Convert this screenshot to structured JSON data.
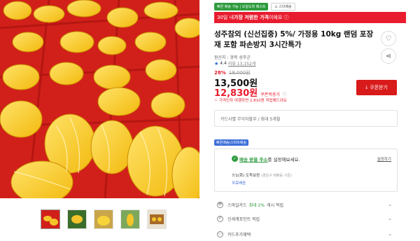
{
  "product": {
    "badge_green": "빠른 배송 가능 | 오늘도착 베스트",
    "badge_store": "스타배송",
    "promo_prefix": "30일 내 ",
    "promo_bold": "가장 저렴한 가격",
    "promo_suffix": "이에요 ⓘ",
    "title": "성주참외 (신선집중) 5%/ 가정용 10kg 랜덤 포장재 포함 파손방지 3시간특가",
    "origin": "원산지 : 경북 성주군",
    "rating": "4.4",
    "reviews": "리뷰 13,152개",
    "discount_pct": "28%",
    "original_price": "18,000원",
    "price": "13,500원",
    "coupon_price": "12,830원",
    "coupon_price_label": "쿠폰적용가",
    "coupon_button": "쿠폰받기",
    "card_benefit": "가격인하 여행하면 2,810원 적립해드려요",
    "installment": "카드사별 무이자할부 / 최대 5개월",
    "tag": "빠른배송/스마트배송",
    "delivery_addr_green": "배송 받을 주소",
    "delivery_addr_suffix": "를 설정해보세요.",
    "delivery_setting": "설정하기",
    "delivery_eta": "7/1(화) 도착보장",
    "delivery_eta_sub": "(경남구 택배등 기준)",
    "delivery_free": "무료배송",
    "acc_smilecard_pre": "스마일카드 ",
    "acc_smilecard_hl": "최대 2%",
    "acc_smilecard_post": " 캐시 적립",
    "acc_shinsegae": "신세계포인트 적립",
    "acc_card_extra": "카드추가혜택"
  },
  "icons": {
    "heart": "heart-icon",
    "share": "share-icon",
    "star": "star-icon",
    "chevron": "chevron-down-icon"
  },
  "colors": {
    "brand_red": "#e81c2e",
    "green": "#2e9b3e",
    "blue": "#3c6fd8"
  }
}
